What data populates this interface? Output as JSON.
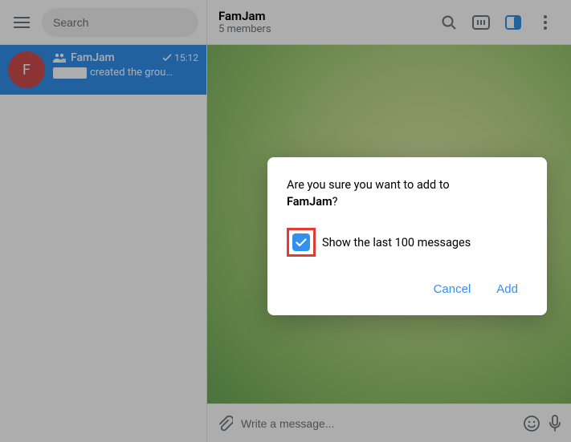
{
  "sidebar": {
    "search_placeholder": "Search",
    "chat": {
      "avatar_letter": "F",
      "name": "FamJam",
      "time": "15:12",
      "preview_text": "created the grou…"
    }
  },
  "header": {
    "title": "FamJam",
    "subtitle": "5 members"
  },
  "composer": {
    "placeholder": "Write a message..."
  },
  "dialog": {
    "line1_a": "Are you sure you want to add ",
    "line1_b": " to ",
    "group": "FamJam",
    "q": "?",
    "check_label": "Show the last 100 messages",
    "cancel": "Cancel",
    "add": "Add"
  }
}
